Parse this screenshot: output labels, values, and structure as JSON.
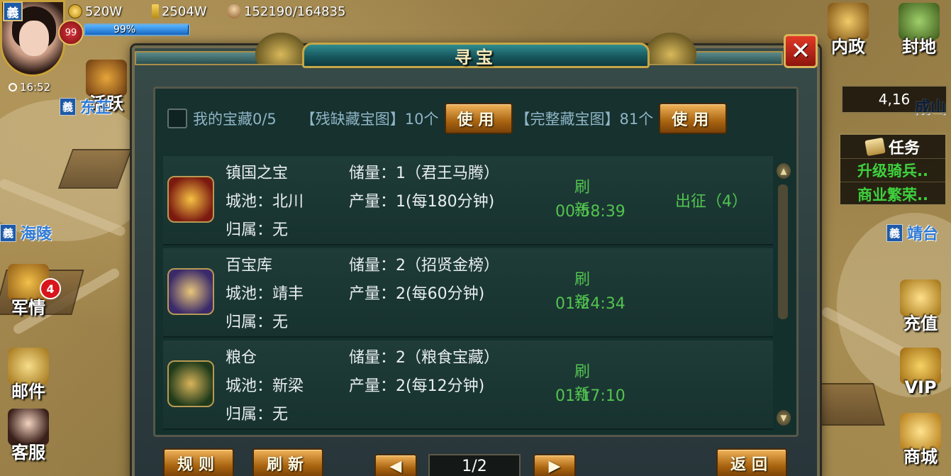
{
  "hud": {
    "player_badge": "義",
    "level": "99",
    "exp_percent": "99%",
    "exp_fill": 0.99,
    "coins": "520W",
    "gold": "2504W",
    "troops": "152190/164835",
    "time": "16:52"
  },
  "left_menu": {
    "activity": "活跃",
    "military": "军情",
    "military_badge": "4",
    "mail": "邮件",
    "service": "客服"
  },
  "map_labels": {
    "city1_badge": "義",
    "city1": "东芷",
    "city2_badge": "義",
    "city2": "海陵",
    "city3_badge": "義",
    "city3": "靖台",
    "city4": "成山"
  },
  "right_menu": {
    "interior": "内政",
    "fief": "封地",
    "coords": "4,16",
    "recharge": "充值",
    "vip": "VIP",
    "shop": "商城"
  },
  "task_panel": {
    "title": "任务",
    "items": [
      "升级骑兵..",
      "商业繁荣.."
    ]
  },
  "modal": {
    "title": "寻宝",
    "close": "✕",
    "my_treasure": "我的宝藏0/5",
    "partial_map": "【残缺藏宝图】10个",
    "use_btn_1": "使用",
    "full_map": "【完整藏宝图】81个",
    "use_btn_2": "使用",
    "rows": [
      {
        "name": "镇国之宝",
        "city": "城池：北川",
        "owner": "归属：无",
        "stock": "储量：1（君王马腾）",
        "output": "产量：1(每180分钟)",
        "refresh": "刷新",
        "timer": "00:58:39",
        "action": "出征（4）"
      },
      {
        "name": "百宝库",
        "city": "城池：靖丰",
        "owner": "归属：无",
        "stock": "储量：2（招贤金榜）",
        "output": "产量：2(每60分钟)",
        "refresh": "刷新",
        "timer": "01:24:34",
        "action": ""
      },
      {
        "name": "粮仓",
        "city": "城池：新梁",
        "owner": "归属：无",
        "stock": "储量：2（粮食宝藏）",
        "output": "产量：2(每12分钟)",
        "refresh": "刷新",
        "timer": "01:17:10",
        "action": ""
      }
    ],
    "rules_btn": "规则",
    "refresh_btn": "刷新",
    "page": "1/2",
    "back_btn": "返回"
  }
}
